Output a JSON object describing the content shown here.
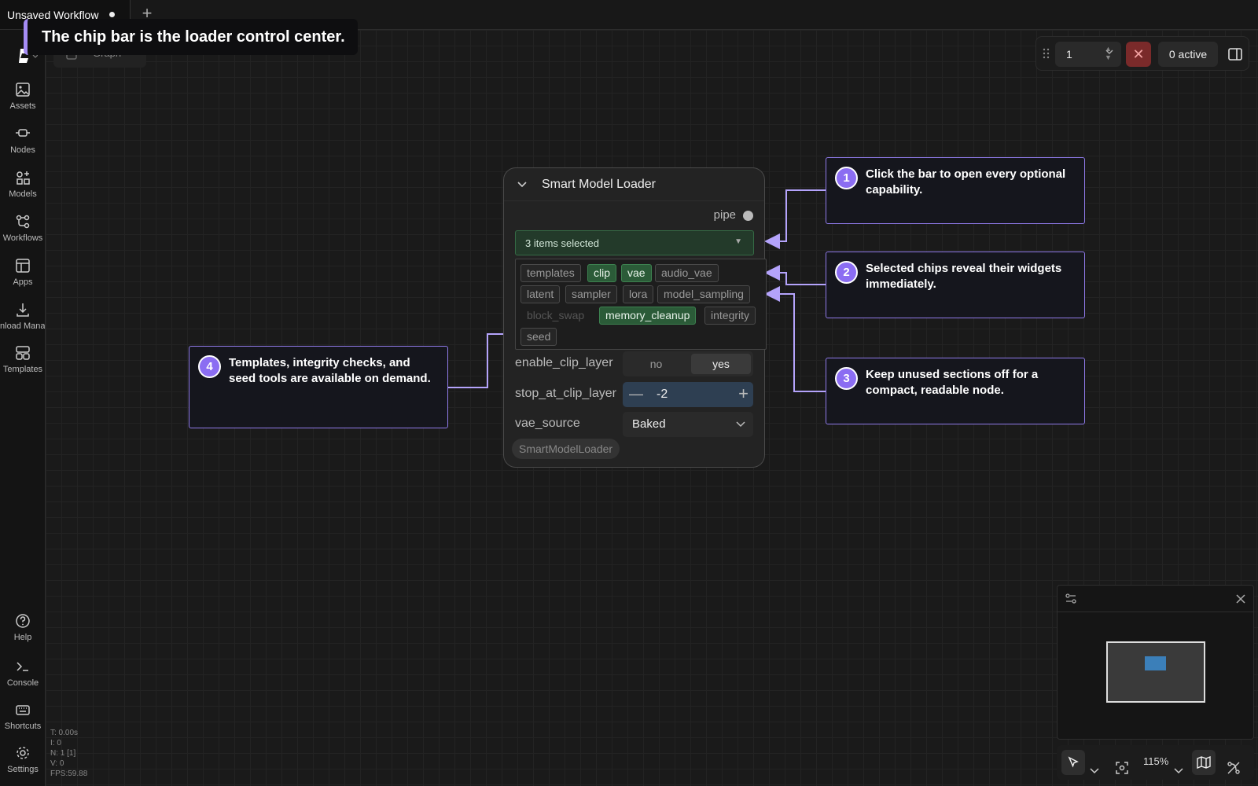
{
  "tabs": {
    "active_label": "Unsaved Workflow",
    "add_label": "+"
  },
  "sidebar": {
    "items": [
      {
        "label": "Assets",
        "icon": "image-icon"
      },
      {
        "label": "Nodes",
        "icon": "node-icon"
      },
      {
        "label": "Models",
        "icon": "models-icon"
      },
      {
        "label": "Workflows",
        "icon": "workflow-icon"
      },
      {
        "label": "Apps",
        "icon": "apps-icon"
      },
      {
        "label": "Download Manager",
        "icon": "download-icon"
      },
      {
        "label": "Templates",
        "icon": "templates-icon"
      }
    ],
    "bottom_items": [
      {
        "label": "Help",
        "icon": "help-icon"
      },
      {
        "label": "Console",
        "icon": "console-icon"
      },
      {
        "label": "Shortcuts",
        "icon": "keyboard-icon"
      },
      {
        "label": "Settings",
        "icon": "gear-icon"
      }
    ]
  },
  "canvas": {
    "graph_label": "Graph"
  },
  "tour": {
    "title": "The chip bar is the loader control center."
  },
  "toolbar": {
    "count_value": "1",
    "cancel_icon": "close-icon",
    "active_label": "0 active"
  },
  "node": {
    "title": "Smart Model Loader",
    "output_label": "pipe",
    "select_label": "3 items selected",
    "chips_row1": [
      "templates",
      "clip",
      "vae",
      "audio_vae"
    ],
    "chips_row2": [
      "latent",
      "sampler",
      "lora",
      "model_sampling"
    ],
    "chips_row3": [
      "block_swap",
      "memory_cleanup",
      "integrity"
    ],
    "chips_row4": [
      "seed"
    ],
    "selected_chips": [
      "clip",
      "vae",
      "memory_cleanup"
    ],
    "widgets": {
      "clip_layer_label": "enable_clip_layer",
      "clip_no": "no",
      "clip_yes": "yes",
      "stop_label": "stop_at_clip_layer",
      "stop_value": "-2",
      "stop_minus": "—",
      "stop_plus": "+",
      "vae_label": "vae_source",
      "vae_value": "Baked"
    },
    "badge": "SmartModelLoader"
  },
  "callouts": [
    {
      "num": "1",
      "text": "Click the bar to open every optional capability."
    },
    {
      "num": "2",
      "text": "Selected chips reveal their widgets immediately."
    },
    {
      "num": "3",
      "text": "Keep unused sections off for a compact, readable node."
    },
    {
      "num": "4",
      "text": "Templates, integrity checks, and seed tools are available on demand."
    }
  ],
  "bottom_controls": {
    "zoom": "115%"
  },
  "stats": {
    "t": "T: 0.00s",
    "i": "I: 0",
    "n": "N: 1 [1]",
    "v": "V: 0",
    "fps": "FPS:59.88"
  },
  "colors": {
    "accent": "#8b6df2",
    "chip_selected": "#2b5b38",
    "cancel": "#7a2a2a",
    "minimap_node": "#3b7fb9"
  }
}
